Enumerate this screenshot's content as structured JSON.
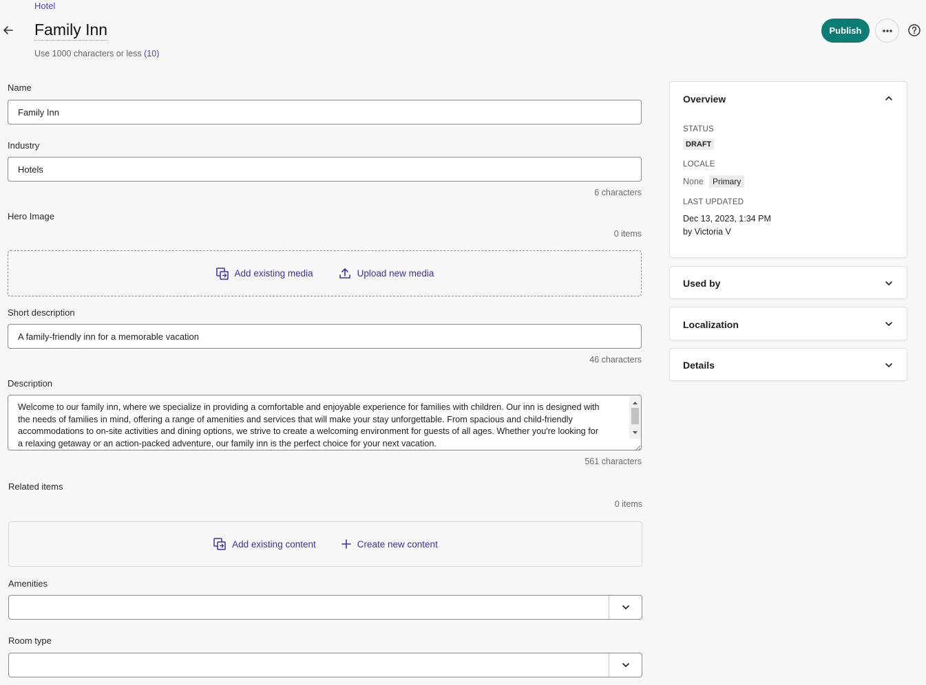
{
  "header": {
    "breadcrumb": "Hotel",
    "title": "Family Inn",
    "title_hint_prefix": "Use 1000 characters or less",
    "title_hint_count": "(10)",
    "publish_label": "Publish"
  },
  "form": {
    "name": {
      "label": "Name",
      "value": "Family Inn"
    },
    "industry": {
      "label": "Industry",
      "value": "Hotels",
      "count": "6 characters"
    },
    "hero_image": {
      "label": "Hero Image",
      "count": "0 items",
      "add_existing_label": "Add existing media",
      "upload_label": "Upload new media"
    },
    "short_description": {
      "label": "Short description",
      "value": "A family-friendly inn for a memorable vacation",
      "count": "46 characters"
    },
    "description": {
      "label": "Description",
      "value": "Welcome to our family inn, where we specialize in providing a comfortable and enjoyable experience for families with children. Our inn is designed with the needs of families in mind, offering a range of amenities and services that will make your stay unforgettable. From spacious and child-friendly accommodations to on-site activities and dining options, we strive to create a welcoming environment for guests of all ages. Whether you're looking for a relaxing getaway or an action-packed adventure, our family inn is the perfect choice for your next vacation.",
      "count": "561 characters"
    },
    "related_items": {
      "label": "Related items",
      "count": "0 items",
      "add_existing_label": "Add existing content",
      "create_label": "Create new content"
    },
    "amenities": {
      "label": "Amenities",
      "value": ""
    },
    "room_type": {
      "label": "Room type",
      "value": ""
    }
  },
  "sidebar": {
    "overview": {
      "title": "Overview",
      "status_label": "STATUS",
      "status_value": "DRAFT",
      "locale_label": "LOCALE",
      "locale_value": "None",
      "locale_badge": "Primary",
      "updated_label": "LAST UPDATED",
      "updated_date": "Dec 13, 2023, 1:34 PM",
      "updated_by": "by Victoria V"
    },
    "used_by": {
      "title": "Used by"
    },
    "localization": {
      "title": "Localization"
    },
    "details": {
      "title": "Details"
    }
  },
  "colors": {
    "accent": "#0c7d75",
    "link": "#3a2fb0",
    "background": "#f7f7f7"
  },
  "icons": {
    "back": "arrow-left-icon",
    "more": "ellipsis-icon",
    "help": "help-circle-icon",
    "add_existing": "copy-link-icon",
    "upload": "upload-icon",
    "create": "plus-icon",
    "expand": "chevron-down-icon",
    "collapse": "chevron-up-icon"
  }
}
